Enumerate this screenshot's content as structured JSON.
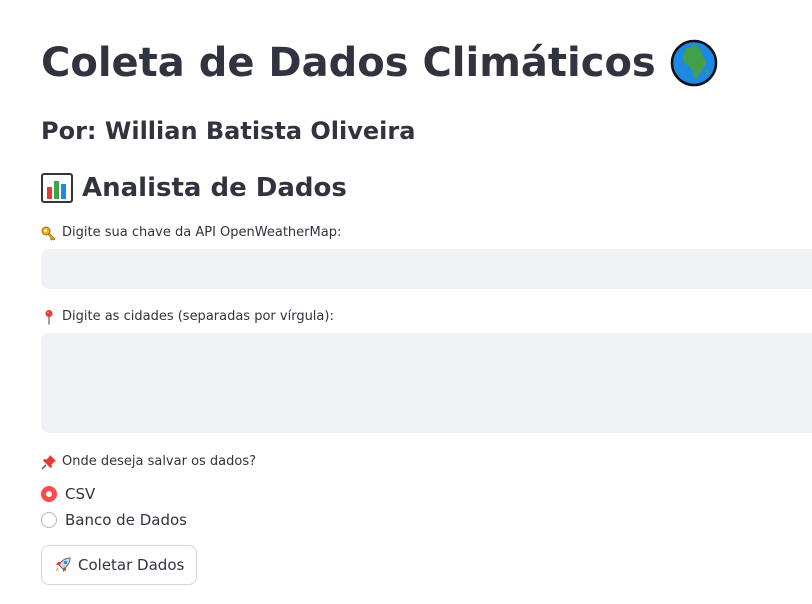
{
  "header": {
    "title": "Coleta de Dados Climáticos",
    "title_icon": "globe-africa-icon",
    "subtitle": "Por: Willian Batista Oliveira"
  },
  "section": {
    "title": "Analista de Dados",
    "icon": "bar-chart-icon"
  },
  "form": {
    "api_key": {
      "label": "Digite sua chave da API OpenWeatherMap:",
      "icon": "key-icon",
      "value": "",
      "placeholder": ""
    },
    "cities": {
      "label": "Digite as cidades (separadas por vírgula):",
      "icon": "pin-icon",
      "value": "",
      "placeholder": ""
    },
    "storage": {
      "label": "Onde deseja salvar os dados?",
      "icon": "pushpin-icon",
      "options": [
        "CSV",
        "Banco de Dados"
      ],
      "selected": "CSV"
    },
    "submit": {
      "label": "Coletar Dados",
      "icon": "rocket-icon"
    }
  },
  "colors": {
    "accent": "#ff4b4b",
    "text": "#31333f",
    "input_bg": "#f0f2f6",
    "border": "#d6d6d9"
  }
}
